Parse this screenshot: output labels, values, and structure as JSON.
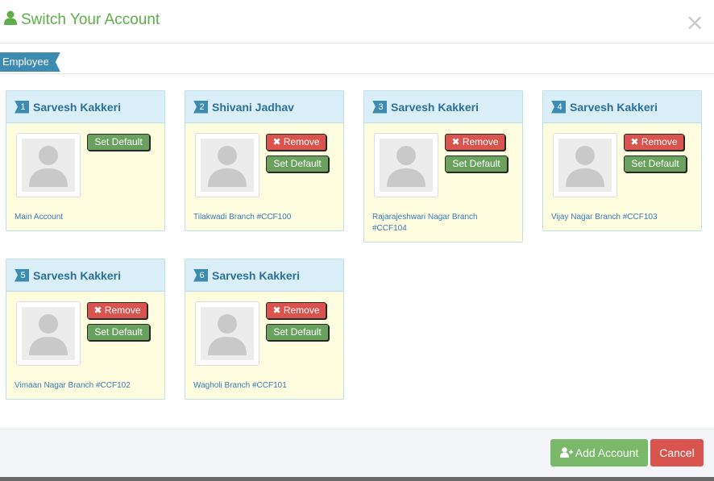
{
  "header": {
    "title": "Switch Your Account",
    "close_glyph": "×"
  },
  "tab": {
    "label": "Employee"
  },
  "icons": {
    "title": "user-icon",
    "close": "close-icon",
    "remove": "times-icon",
    "add": "user-plus-icon"
  },
  "cards": [
    {
      "number": "1",
      "name": "Sarvesh Kakkeri",
      "branch": "Main Account",
      "remove_label": "",
      "default_label": "Set Default"
    },
    {
      "number": "2",
      "name": "Shivani Jadhav",
      "branch": "Tilakwadi Branch #CCF100",
      "remove_label": "Remove",
      "default_label": "Set Default"
    },
    {
      "number": "3",
      "name": "Sarvesh Kakkeri",
      "branch": "Rajarajeshwari Nagar Branch #CCF104",
      "remove_label": "Remove",
      "default_label": "Set Default"
    },
    {
      "number": "4",
      "name": "Sarvesh Kakkeri",
      "branch": "Vijay Nagar Branch #CCF103",
      "remove_label": "Remove",
      "default_label": "Set Default"
    },
    {
      "number": "5",
      "name": "Sarvesh Kakkeri",
      "branch": "Vimaan Nagar Branch #CCF102",
      "remove_label": "Remove",
      "default_label": "Set Default"
    },
    {
      "number": "6",
      "name": "Sarvesh Kakkeri",
      "branch": "Wagholi Branch #CCF101",
      "remove_label": "Remove",
      "default_label": "Set Default"
    }
  ],
  "footer": {
    "add_label": "Add Account",
    "cancel_label": "Cancel"
  },
  "colors": {
    "title": "#5fae4a",
    "ribbon": "#3d8bb1",
    "card_bg": "#fffde0",
    "card_head": "#d9eef7",
    "remove": "#d9534f",
    "set_default": "#6aa15f",
    "add": "#7ab86a"
  }
}
